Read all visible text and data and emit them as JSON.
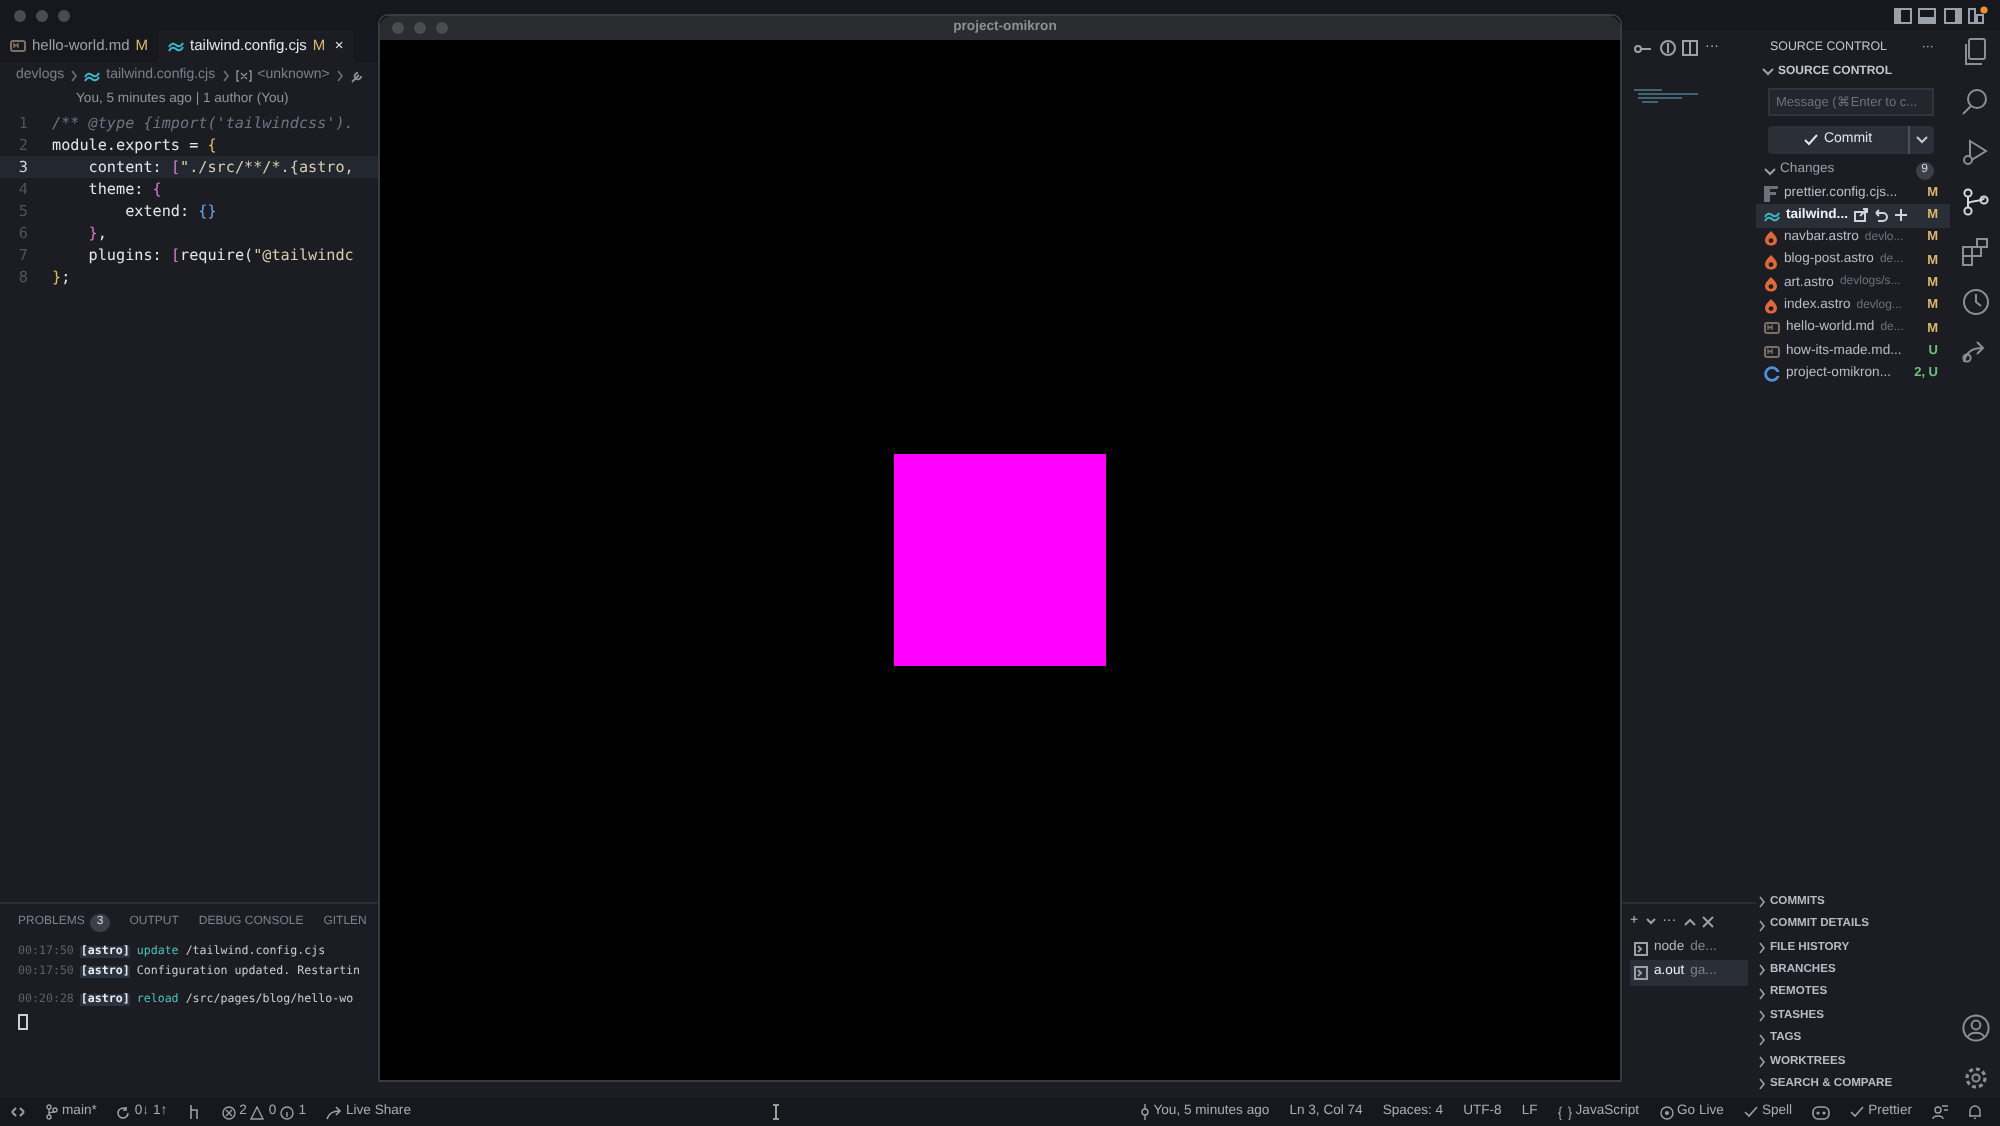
{
  "editor_tabs": [
    {
      "label": "hello-world.md",
      "status": "M",
      "kind": "markdown",
      "selected": false
    },
    {
      "label": "tailwind.config.cjs",
      "status": "M",
      "kind": "tailwind",
      "selected": true,
      "close": "×"
    }
  ],
  "breadcrumb": [
    "devlogs",
    "tailwind.config.cjs",
    "<unknown>"
  ],
  "blame": "You, 5 minutes ago | 1 author (You)",
  "code": [
    {
      "number": "1",
      "active": false,
      "tokens": [
        {
          "kind": "comment",
          "text": "/** @type {import('tailwindcss')."
        }
      ]
    },
    {
      "number": "2",
      "active": false,
      "tokens": [
        {
          "kind": "plain",
          "text": "module.exports = "
        },
        {
          "kind": "brace",
          "text": "{"
        }
      ]
    },
    {
      "number": "3",
      "active": true,
      "tokens": [
        {
          "kind": "plain",
          "text": "    content: "
        },
        {
          "kind": "bracket",
          "text": "["
        },
        {
          "kind": "string",
          "text": "\"./src/**/*.{astro,"
        }
      ]
    },
    {
      "number": "4",
      "active": false,
      "tokens": [
        {
          "kind": "plain",
          "text": "    theme: "
        },
        {
          "kind": "bracket",
          "text": "{"
        }
      ]
    },
    {
      "number": "5",
      "active": false,
      "tokens": [
        {
          "kind": "plain",
          "text": "        extend: "
        },
        {
          "kind": "inner",
          "text": "{}"
        }
      ]
    },
    {
      "number": "6",
      "active": false,
      "tokens": [
        {
          "kind": "bracket",
          "text": "    }"
        },
        {
          "kind": "plain",
          "text": ","
        }
      ]
    },
    {
      "number": "7",
      "active": false,
      "tokens": [
        {
          "kind": "plain",
          "text": "    plugins: "
        },
        {
          "kind": "bracket",
          "text": "["
        },
        {
          "kind": "plain",
          "text": "require("
        },
        {
          "kind": "string",
          "text": "\"@tailwindc"
        }
      ]
    },
    {
      "number": "8",
      "active": false,
      "tokens": [
        {
          "kind": "brace",
          "text": "}"
        },
        {
          "kind": "plain",
          "text": ";"
        }
      ]
    }
  ],
  "panel": {
    "tabs": [
      {
        "label": "PROBLEMS",
        "count": "3",
        "selected": false
      },
      {
        "label": "OUTPUT",
        "selected": false
      },
      {
        "label": "DEBUG CONSOLE",
        "selected": false
      },
      {
        "label": "GITLEN",
        "selected": false
      }
    ],
    "terminal": [
      {
        "time": "00:17:50",
        "tag": "[astro]",
        "action": "update",
        "message": "/tailwind.config.cjs"
      },
      {
        "time": "00:17:50",
        "tag": "[astro]",
        "message": "Configuration updated. Restartin"
      },
      {
        "time": "00:20:28",
        "tag": "[astro]",
        "action": "reload",
        "message": "/src/pages/blog/hello-wo"
      }
    ],
    "actions": {
      "add": "+",
      "more": "···"
    },
    "terminals": [
      {
        "name": "node",
        "detail": "de...",
        "selected": false
      },
      {
        "name": "a.out",
        "detail": "ga...",
        "selected": true
      }
    ]
  },
  "editor_actions": {
    "more": "···"
  },
  "app_window": {
    "title": "project-omikron"
  },
  "sidebar": {
    "title": "SOURCE CONTROL",
    "more": "···",
    "section": "SOURCE CONTROL",
    "message_placeholder": "Message (⌘Enter to c...",
    "commit": "Commit",
    "changes_label": "Changes",
    "changes_count": "9",
    "files": [
      {
        "name": "prettier.config.cjs...",
        "status": "M",
        "kind": "prettier",
        "color": "#d9b86f",
        "selected": false
      },
      {
        "name": "tailwind...",
        "status": "M",
        "kind": "tailwind",
        "color": "#d9b86f",
        "selected": true
      },
      {
        "name": "navbar.astro",
        "detail": "devlo...",
        "status": "M",
        "kind": "astro",
        "color": "#d9b86f",
        "selected": false
      },
      {
        "name": "blog-post.astro",
        "detail": "de...",
        "status": "M",
        "kind": "astro",
        "color": "#d9b86f",
        "selected": false
      },
      {
        "name": "art.astro",
        "detail": "devlogs/s...",
        "status": "M",
        "kind": "astro",
        "color": "#d9b86f",
        "selected": false
      },
      {
        "name": "index.astro",
        "detail": "devlog...",
        "status": "M",
        "kind": "astro",
        "color": "#d9b86f",
        "selected": false
      },
      {
        "name": "hello-world.md",
        "detail": "de...",
        "status": "M",
        "kind": "markdown",
        "color": "#d9b86f",
        "selected": false
      },
      {
        "name": "how-its-made.md...",
        "status": "U",
        "kind": "markdown",
        "color": "#71c07c",
        "selected": false
      },
      {
        "name": "project-omikron...",
        "status": "2, U",
        "kind": "c",
        "color": "#71c07c",
        "selected": false
      }
    ],
    "sections": [
      {
        "label": "COMMITS"
      },
      {
        "label": "COMMIT DETAILS"
      },
      {
        "label": "FILE HISTORY"
      },
      {
        "label": "BRANCHES"
      },
      {
        "label": "REMOTES"
      },
      {
        "label": "STASHES"
      },
      {
        "label": "TAGS"
      },
      {
        "label": "WORKTREES"
      },
      {
        "label": "SEARCH & COMPARE"
      }
    ]
  },
  "status_bar": {
    "left": [
      {
        "kind": "remote"
      },
      {
        "kind": "branch",
        "text": "main*"
      },
      {
        "kind": "sync",
        "text": "0↓ 1↑"
      },
      {
        "kind": "graph"
      },
      {
        "kind": "problems",
        "text": "2",
        "warnings": "0",
        "info": "1"
      },
      {
        "kind": "share",
        "text": "Live Share"
      }
    ],
    "right": [
      {
        "kind": "blame",
        "text": "You, 5 minutes ago"
      },
      {
        "kind": "plain",
        "text": "Ln 3, Col 74"
      },
      {
        "kind": "plain",
        "text": "Spaces: 4"
      },
      {
        "kind": "plain",
        "text": "UTF-8"
      },
      {
        "kind": "plain",
        "text": "LF"
      },
      {
        "kind": "language",
        "text": "JavaScript"
      },
      {
        "kind": "live",
        "text": "Go Live"
      },
      {
        "kind": "check",
        "text": "Spell"
      },
      {
        "kind": "copilot"
      },
      {
        "kind": "check",
        "text": "Prettier"
      },
      {
        "kind": "feedback"
      },
      {
        "kind": "bell"
      }
    ]
  }
}
